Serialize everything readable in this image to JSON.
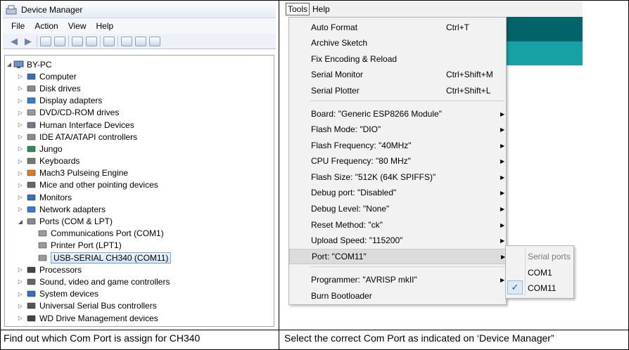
{
  "device_manager": {
    "title": "Device Manager",
    "menu": [
      "File",
      "Action",
      "View",
      "Help"
    ],
    "root": "BY-PC",
    "tree": [
      {
        "label": "Computer",
        "icon": "computer-icon",
        "color": "#3a6fb5"
      },
      {
        "label": "Disk drives",
        "icon": "disk-drive-icon",
        "color": "#8a8a8a"
      },
      {
        "label": "Display adapters",
        "icon": "display-adapter-icon",
        "color": "#3a7ad0"
      },
      {
        "label": "DVD/CD-ROM drives",
        "icon": "dvd-drive-icon",
        "color": "#9a9a9a"
      },
      {
        "label": "Human Interface Devices",
        "icon": "hid-icon",
        "color": "#6c7a8a"
      },
      {
        "label": "IDE ATA/ATAPI controllers",
        "icon": "ide-controller-icon",
        "color": "#8a8a8a"
      },
      {
        "label": "Jungo",
        "icon": "jungo-icon",
        "color": "#2e8b57"
      },
      {
        "label": "Keyboards",
        "icon": "keyboard-icon",
        "color": "#777777"
      },
      {
        "label": "Mach3 Pulseing Engine",
        "icon": "mach3-icon",
        "color": "#e07b20"
      },
      {
        "label": "Mice and other pointing devices",
        "icon": "mouse-icon",
        "color": "#666666"
      },
      {
        "label": "Monitors",
        "icon": "monitor-icon",
        "color": "#3a6fb5"
      },
      {
        "label": "Network adapters",
        "icon": "network-adapter-icon",
        "color": "#3a7ad0"
      },
      {
        "label": "Ports (COM & LPT)",
        "icon": "port-icon",
        "color": "#8a8a8a",
        "expanded": true
      },
      {
        "label": "Communications Port (COM1)",
        "icon": "port-icon",
        "color": "#9a9a9a",
        "child": true
      },
      {
        "label": "Printer Port (LPT1)",
        "icon": "port-icon",
        "color": "#9a9a9a",
        "child": true
      },
      {
        "label": "USB-SERIAL CH340 (COM11)",
        "icon": "port-icon",
        "color": "#9a9a9a",
        "child": true,
        "selected": true
      },
      {
        "label": "Processors",
        "icon": "processor-icon",
        "color": "#444444"
      },
      {
        "label": "Sound, video and game controllers",
        "icon": "sound-icon",
        "color": "#666666"
      },
      {
        "label": "System devices",
        "icon": "system-device-icon",
        "color": "#3a6fb5"
      },
      {
        "label": "Universal Serial Bus controllers",
        "icon": "usb-icon",
        "color": "#555555"
      },
      {
        "label": "WD Drive Management devices",
        "icon": "wd-icon",
        "color": "#444444"
      }
    ]
  },
  "arduino": {
    "menubar": {
      "tools": "Tools",
      "help": "Help"
    },
    "menu_items": [
      {
        "label": "Auto Format",
        "shortcut": "Ctrl+T"
      },
      {
        "label": "Archive Sketch",
        "shortcut": ""
      },
      {
        "label": "Fix Encoding & Reload",
        "shortcut": ""
      },
      {
        "label": "Serial Monitor",
        "shortcut": "Ctrl+Shift+M"
      },
      {
        "label": "Serial Plotter",
        "shortcut": "Ctrl+Shift+L"
      },
      {
        "label": "Board: \"Generic ESP8266 Module\"",
        "submenu": true
      },
      {
        "label": "Flash Mode: \"DIO\"",
        "submenu": true
      },
      {
        "label": "Flash Frequency: \"40MHz\"",
        "submenu": true
      },
      {
        "label": "CPU Frequency: \"80 MHz\"",
        "submenu": true
      },
      {
        "label": "Flash Size: \"512K (64K SPIFFS)\"",
        "submenu": true
      },
      {
        "label": "Debug port: \"Disabled\"",
        "submenu": true
      },
      {
        "label": "Debug Level: \"None\"",
        "submenu": true
      },
      {
        "label": "Reset Method: \"ck\"",
        "submenu": true
      },
      {
        "label": "Upload Speed: \"115200\"",
        "submenu": true
      },
      {
        "label": "Port: \"COM11\"",
        "submenu": true,
        "highlighted": true
      },
      {
        "label": "Programmer: \"AVRISP mkII\"",
        "submenu": true
      },
      {
        "label": "Burn Bootloader",
        "shortcut": ""
      }
    ],
    "ports_submenu": {
      "header": "Serial ports",
      "items": [
        "COM1",
        "COM11"
      ],
      "checked": "COM11",
      "check_glyph": "✓"
    },
    "colors": {
      "teal_dark": "#006468",
      "teal_light": "#17a1a5"
    }
  },
  "captions": {
    "left": "Find out which Com Port is assign for CH340",
    "right": "Select the correct Com Port as indicated on ‘Device Manager”"
  }
}
